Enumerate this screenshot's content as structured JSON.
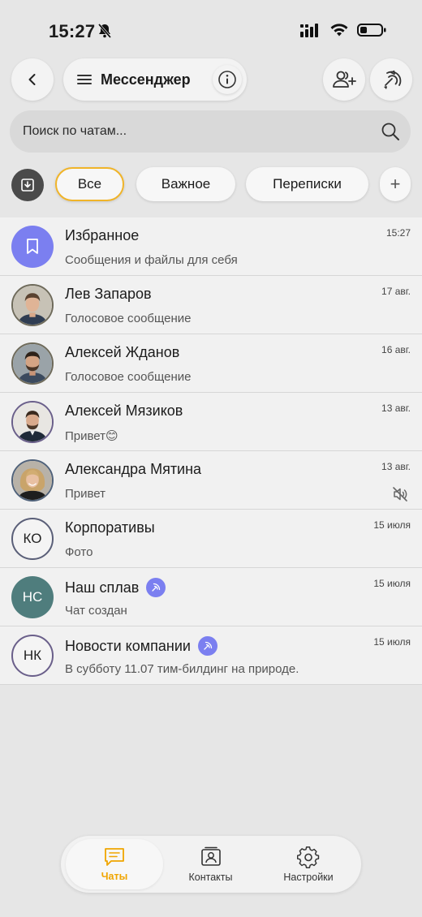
{
  "status_bar": {
    "time": "15:27"
  },
  "header": {
    "title": "Мессенджер"
  },
  "search": {
    "placeholder": "Поиск по чатам..."
  },
  "filters": {
    "chips": [
      "Все",
      "Важное",
      "Переписки"
    ],
    "active_chip": "Все",
    "add": "+"
  },
  "chats": [
    {
      "name": "Избранное",
      "preview": "Сообщения и файлы для себя",
      "time": "15:27",
      "avatar": "bookmark-icon"
    },
    {
      "name": "Лев Запаров",
      "preview": "Голосовое сообщение",
      "time": "17 авг.",
      "avatar": "photo"
    },
    {
      "name": "Алексей Жданов",
      "preview": "Голосовое сообщение",
      "time": "16 авг.",
      "avatar": "photo"
    },
    {
      "name": "Алексей Мязиков",
      "preview": "Привет😊",
      "time": "13 авг.",
      "avatar": "photo"
    },
    {
      "name": "Александра Мятина",
      "preview": "Привет",
      "time": "13 авг.",
      "avatar": "photo",
      "muted": true
    },
    {
      "name": "Корпоративы",
      "preview": "Фото",
      "time": "15 июля",
      "initials": "КО"
    },
    {
      "name": "Наш сплав",
      "preview": "Чат создан",
      "time": "15 июля",
      "initials": "НС",
      "group": true
    },
    {
      "name": "Новости компании",
      "preview": "В субботу 11.07 тим-билдинг на природе.",
      "time": "15 июля",
      "initials": "НК",
      "group": true
    }
  ],
  "bottom_nav": {
    "chats": "Чаты",
    "contacts": "Контакты",
    "settings": "Настройки",
    "active": "Чаты"
  },
  "colors": {
    "accent": "#f0b429",
    "active_nav": "#f0a500",
    "favorites": "#7b7ff0",
    "teal_avatar": "#4f7d7d"
  }
}
